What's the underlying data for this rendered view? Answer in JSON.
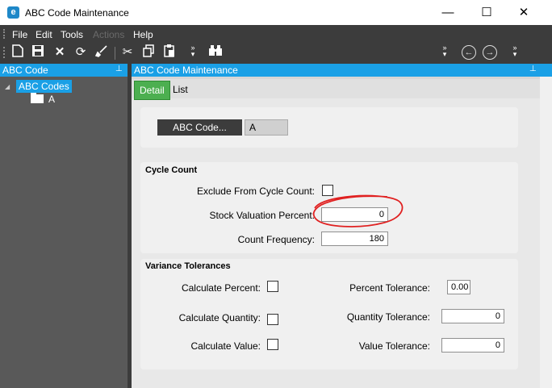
{
  "window": {
    "title": "ABC Code Maintenance",
    "app_icon_letter": "e",
    "minimize": "—",
    "maximize": "☐",
    "close": "✕"
  },
  "menu": {
    "items": [
      {
        "label": "File",
        "enabled": true
      },
      {
        "label": "Edit",
        "enabled": true
      },
      {
        "label": "Tools",
        "enabled": true
      },
      {
        "label": "Actions",
        "enabled": false
      },
      {
        "label": "Help",
        "enabled": true
      }
    ]
  },
  "toolbar": {
    "icons": [
      "new-icon",
      "save-icon",
      "delete-icon",
      "refresh-icon",
      "clear-icon",
      "cut-icon",
      "copy-icon",
      "paste-icon",
      "overflow-icon",
      "binoculars-icon",
      "overflow-icon",
      "back-icon",
      "forward-icon",
      "overflow-icon"
    ]
  },
  "left_panel": {
    "header": "ABC Code",
    "pin": "📌",
    "tree_root": "ABC Codes",
    "tree_child": "A"
  },
  "right_panel": {
    "header": "ABC Code Maintenance",
    "pin": "📌",
    "tabs": [
      {
        "label": "Detail",
        "active": true
      },
      {
        "label": "List",
        "active": false
      }
    ]
  },
  "form": {
    "abc_code_button": "ABC Code...",
    "abc_code_value": "A",
    "cycle_count": {
      "title": "Cycle Count",
      "exclude_label": "Exclude From Cycle Count:",
      "exclude_checked": false,
      "stock_valuation_label": "Stock Valuation Percent:",
      "stock_valuation_value": "0",
      "count_frequency_label": "Count Frequency:",
      "count_frequency_value": "180"
    },
    "variance": {
      "title": "Variance Tolerances",
      "calc_percent_label": "Calculate Percent:",
      "calc_quantity_label": "Calculate Quantity:",
      "calc_value_label": "Calculate Value:",
      "percent_tol_label": "Percent Tolerance:",
      "percent_tol_value": "0.00",
      "quantity_tol_label": "Quantity Tolerance:",
      "quantity_tol_value": "0",
      "value_tol_label": "Value Tolerance:",
      "value_tol_value": "0"
    }
  },
  "colors": {
    "accent": "#1aa0e6",
    "annotation": "#e02020",
    "active_tab": "#4caf50"
  }
}
